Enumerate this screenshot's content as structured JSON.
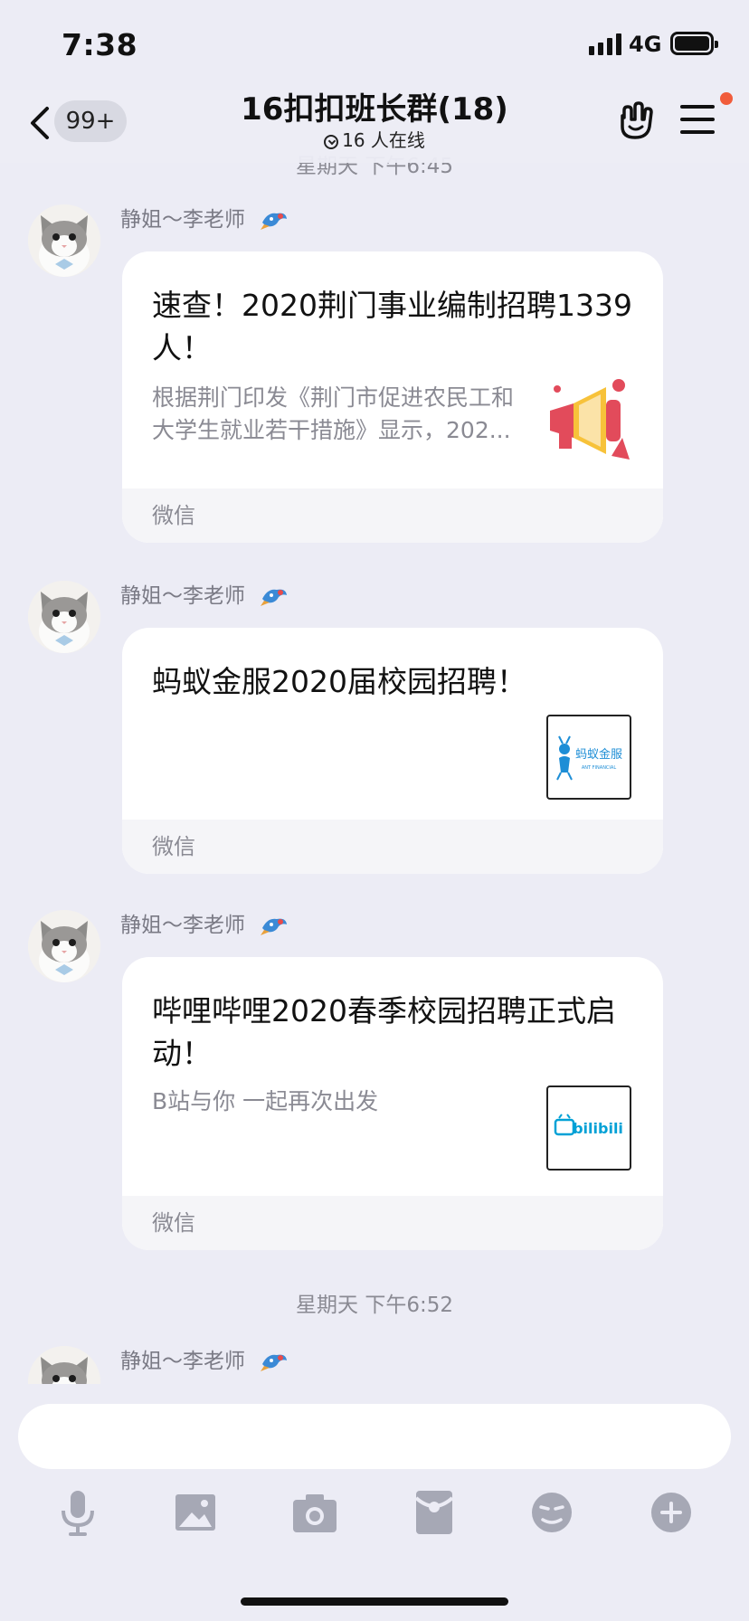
{
  "status_bar": {
    "time": "7:38",
    "network": "4G"
  },
  "header": {
    "unread_badge": "99+",
    "title": "16扣扣班长群(18)",
    "online_status": "16 人在线",
    "previous_time_separator": "星期天 下午6:45"
  },
  "messages": [
    {
      "sender": "静姐～李老师",
      "title": "速查！2020荆门事业编制招聘1339人！",
      "description": "根据荆门印发《荆门市促进农民工和大学生就业若干措施》显示，202...",
      "source": "微信",
      "thumbnail_icon": "megaphone-icon"
    },
    {
      "sender": "静姐～李老师",
      "title": "蚂蚁金服2020届校园招聘！",
      "description": "",
      "source": "微信",
      "thumbnail_icon": "ant-financial-logo",
      "thumbnail_text": "蚂蚁金服",
      "thumbnail_subtext": "ANT FINANCIAL"
    },
    {
      "sender": "静姐～李老师",
      "title": "哔哩哔哩2020春季校园招聘正式启动！",
      "description": "B站与你 一起再次出发",
      "source": "微信",
      "thumbnail_icon": "bilibili-logo",
      "thumbnail_text": "bilibili"
    }
  ],
  "time_separator": "星期天 下午6:52",
  "last_message": {
    "sender": "静姐～李老师"
  },
  "input": {
    "placeholder": "",
    "value": ""
  },
  "toolbar_icons": [
    "microphone-icon",
    "image-icon",
    "camera-icon",
    "red-packet-icon",
    "emoji-icon",
    "plus-icon"
  ],
  "colors": {
    "background": "#ececf5",
    "notification_dot": "#f15c3b",
    "bilibili_blue": "#00a1d6",
    "megaphone_red": "#e24b5b",
    "megaphone_yellow": "#f7c23a"
  }
}
